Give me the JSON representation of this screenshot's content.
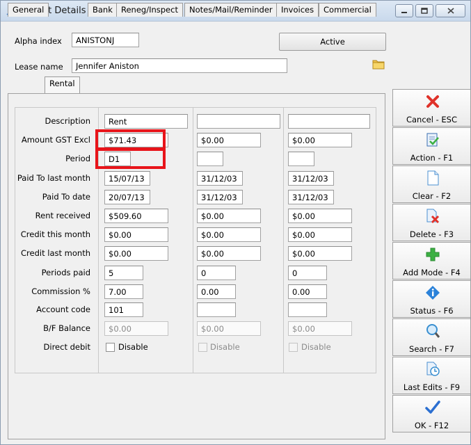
{
  "window": {
    "title": "Tenant Details"
  },
  "header": {
    "alpha_index_label": "Alpha index",
    "alpha_index_value": "ANISTONJ",
    "status_button": "Active",
    "lease_name_label": "Lease name",
    "lease_name_value": "Jennifer Aniston"
  },
  "tabs": [
    "General",
    "Rental",
    "Bank",
    "Reneg/Inspect",
    "Notes/Mail/Reminder",
    "Invoices",
    "Commercial"
  ],
  "selected_tab": "Rental",
  "rental": {
    "row_labels": [
      "Description",
      "Amount GST Excl",
      "Period",
      "Paid To last month",
      "Paid To date",
      "Rent received",
      "Credit this month",
      "Credit last month",
      "Periods paid",
      "Commission %",
      "Account code",
      "B/F Balance",
      "Direct debit"
    ],
    "columns": [
      {
        "description": "Rent",
        "amount": "$71.43",
        "period": "D1",
        "paid_last_month": "15/07/13",
        "paid_to_date": "20/07/13",
        "rent_received": "$509.60",
        "credit_this_month": "$0.00",
        "credit_last_month": "$0.00",
        "periods_paid": "5",
        "commission": "7.00",
        "account_code": "101",
        "bf_balance": "$0.00",
        "direct_debit_label": "Disable"
      },
      {
        "description": "",
        "amount": "$0.00",
        "period": "",
        "paid_last_month": "31/12/03",
        "paid_to_date": "31/12/03",
        "rent_received": "$0.00",
        "credit_this_month": "$0.00",
        "credit_last_month": "$0.00",
        "periods_paid": "0",
        "commission": "0.00",
        "account_code": "",
        "bf_balance": "$0.00",
        "direct_debit_label": "Disable"
      },
      {
        "description": "",
        "amount": "$0.00",
        "period": "",
        "paid_last_month": "31/12/03",
        "paid_to_date": "31/12/03",
        "rent_received": "$0.00",
        "credit_this_month": "$0.00",
        "credit_last_month": "$0.00",
        "periods_paid": "0",
        "commission": "0.00",
        "account_code": "",
        "bf_balance": "$0.00",
        "direct_debit_label": "Disable"
      }
    ]
  },
  "sidebar": [
    {
      "label": "Cancel - ESC",
      "icon": "cancel-icon",
      "color": "#e0322a"
    },
    {
      "label": "Action - F1",
      "icon": "action-icon",
      "color": "#3a8fd0"
    },
    {
      "label": "Clear - F2",
      "icon": "clear-icon",
      "color": "#4aa0e0"
    },
    {
      "label": "Delete - F3",
      "icon": "delete-icon",
      "color": "#e0322a"
    },
    {
      "label": "Add Mode - F4",
      "icon": "add-icon",
      "color": "#3cb043"
    },
    {
      "label": "Status - F6",
      "icon": "info-icon",
      "color": "#2b82d9"
    },
    {
      "label": "Search - F7",
      "icon": "search-icon",
      "color": "#3a8fd0"
    },
    {
      "label": "Last Edits - F9",
      "icon": "history-icon",
      "color": "#3a8fd0"
    },
    {
      "label": "OK - F12",
      "icon": "ok-icon",
      "color": "#2b6fd1"
    }
  ],
  "highlight_color": "#e8141a"
}
